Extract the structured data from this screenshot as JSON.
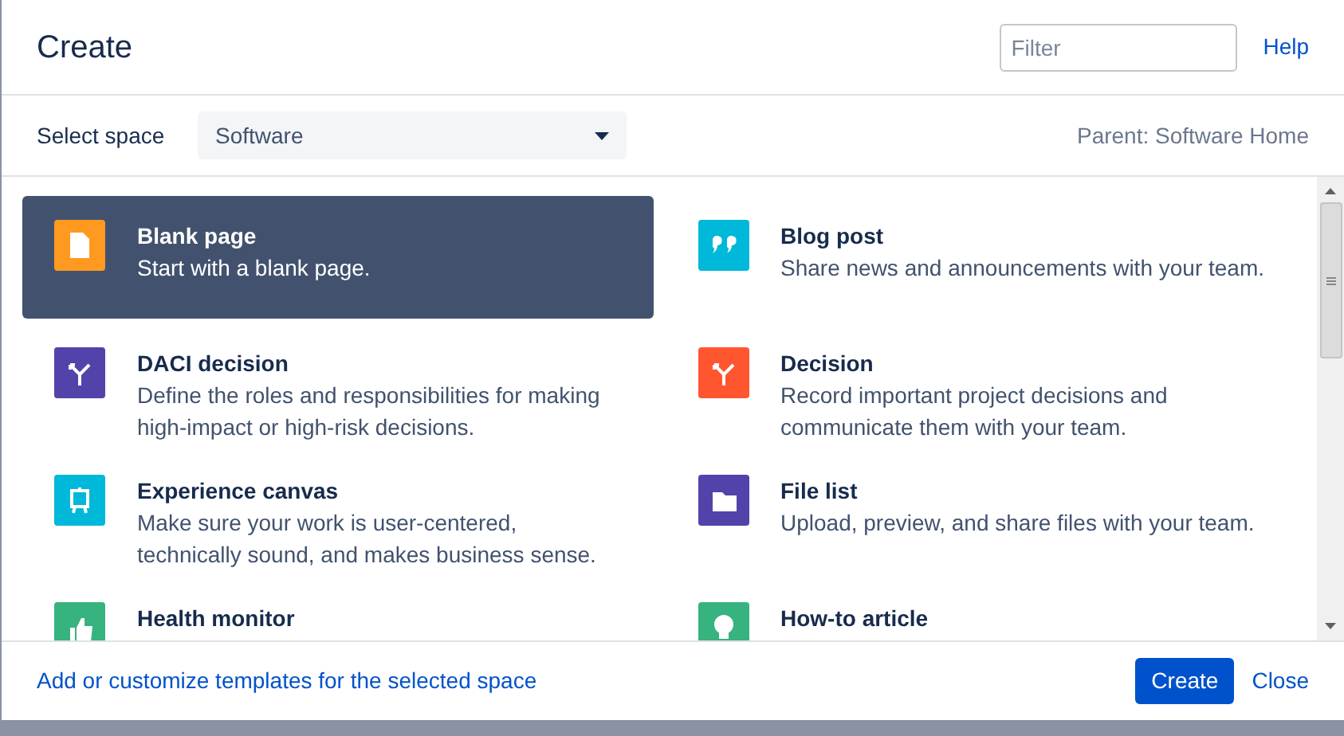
{
  "dialog": {
    "title": "Create",
    "filter": {
      "placeholder": "Filter"
    },
    "help_link": "Help"
  },
  "space": {
    "label": "Select space",
    "value": "Software",
    "parent": "Parent: Software Home"
  },
  "templates": [
    {
      "kind": "page",
      "title": "Blank page",
      "description": "Start with a blank page.",
      "color": "#ff991f",
      "selected": true
    },
    {
      "kind": "quote",
      "title": "Blog post",
      "description": "Share news and announcements with your team.",
      "color": "#00b8d9",
      "selected": false
    },
    {
      "kind": "branch",
      "title": "DACI decision",
      "description": "Define the roles and responsibilities for making high-impact or high-risk decisions.",
      "color": "#5243aa",
      "selected": false
    },
    {
      "kind": "branch",
      "title": "Decision",
      "description": "Record important project decisions and communicate them with your team.",
      "color": "#ff5630",
      "selected": false
    },
    {
      "kind": "easel",
      "title": "Experience canvas",
      "description": "Make sure your work is user-centered, technically sound, and makes business sense.",
      "color": "#00b8d9",
      "selected": false
    },
    {
      "kind": "folder",
      "title": "File list",
      "description": "Upload, preview, and share files with your team.",
      "color": "#5243aa",
      "selected": false
    },
    {
      "kind": "thumb",
      "title": "Health monitor",
      "color": "#36b37e",
      "selected": false
    },
    {
      "kind": "bulb",
      "title": "How-to article",
      "color": "#36b37e",
      "selected": false
    }
  ],
  "footer": {
    "customize_link": "Add or customize templates for the selected space",
    "create_button": "Create",
    "close_link": "Close"
  }
}
